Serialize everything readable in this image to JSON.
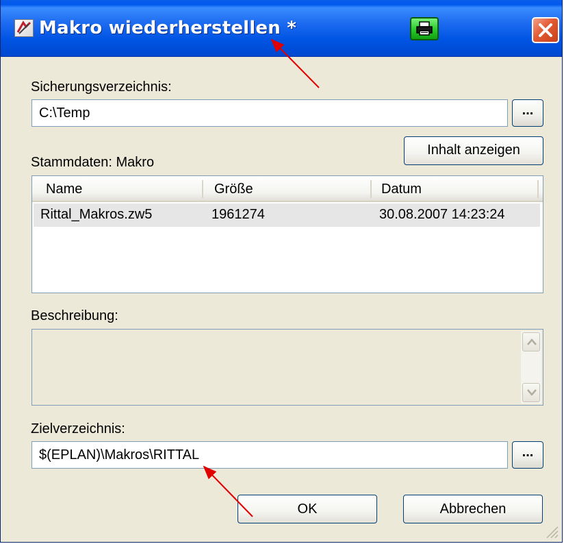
{
  "window": {
    "title": "Makro wiederherstellen *",
    "icons": {
      "app": "macro-restore-icon",
      "print": "printer-icon",
      "close": "close-icon"
    },
    "colors": {
      "titlebar": "#0054e3",
      "body": "#ece9d8",
      "close": "#e25a34",
      "print": "#2ecc2e",
      "annotation": "#e00000"
    }
  },
  "backup": {
    "label": "Sicherungsverzeichnis:",
    "path": "C:\\Temp",
    "browse_label": "..."
  },
  "show_content_label": "Inhalt anzeigen",
  "master_data": {
    "label": "Stammdaten: Makro",
    "columns": [
      "Name",
      "Größe",
      "Datum"
    ],
    "rows": [
      [
        "Rittal_Makros.zw5",
        "1961274",
        "30.08.2007 14:23:24"
      ]
    ]
  },
  "description": {
    "label": "Beschreibung:",
    "text": ""
  },
  "target": {
    "label": "Zielverzeichnis:",
    "path": "$(EPLAN)\\Makros\\RITTAL",
    "browse_label": "..."
  },
  "buttons": {
    "ok": "OK",
    "cancel": "Abbrechen"
  }
}
